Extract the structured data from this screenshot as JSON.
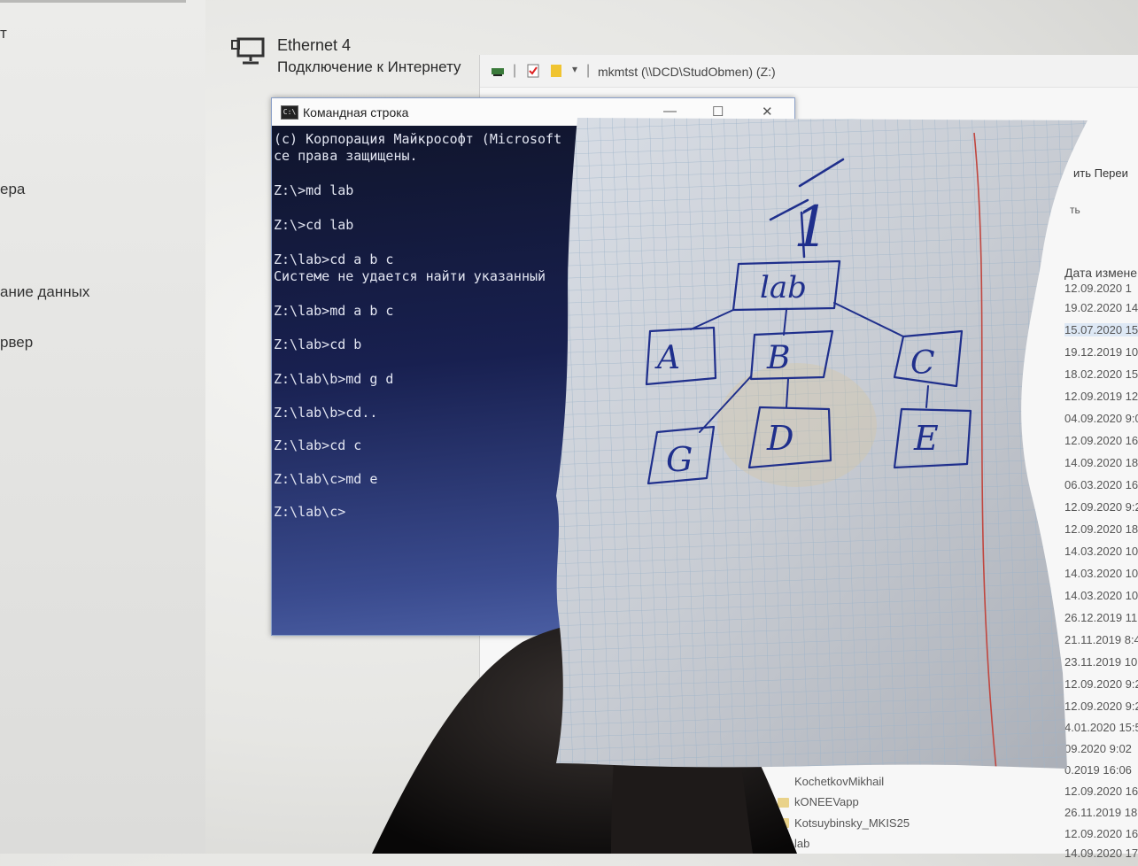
{
  "left_panel": {
    "items": [
      "т",
      "ера",
      "ание данных",
      "рвер"
    ]
  },
  "network": {
    "name": "Ethernet 4",
    "status": "Подключение к Интернету"
  },
  "explorer": {
    "title": "mkmtst (\\\\DCD\\StudObmen) (Z:)",
    "ribbon_label_1": "ить Переи",
    "ribbon_label_2": "ть",
    "date_header": "Дата измене",
    "dates": [
      "12.09.2020 1",
      "19.02.2020 14",
      "15.07.2020 15",
      "19.12.2019 10:",
      "18.02.2020 15:",
      "12.09.2019 12:",
      "04.09.2020 9:0",
      "12.09.2020 16:",
      "14.09.2020 18:0",
      "06.03.2020 16:0",
      "12.09.2020 9:22",
      "12.09.2020 18:1",
      "14.03.2020 10:0",
      "14.03.2020 10:0",
      "14.03.2020 10:0",
      "26.12.2019 11:00",
      "21.11.2019 8:46",
      "23.11.2019 10:50",
      "12.09.2020 9:21",
      "12.09.2020 9:20",
      "4.01.2020 15:57",
      "09.2020 9:02",
      "0.2019 16:06",
      "12.09.2020 16:32",
      "26.11.2019 18:43",
      "12.09.2020 16:42",
      "14.09.2020 17:59"
    ],
    "names": [
      "KochetkovMikhail",
      "kONEEVapp",
      "Kotsuybinsky_MKIS25",
      "lab"
    ]
  },
  "cmd": {
    "title": "Командная строка",
    "minimize": "—",
    "maximize": "☐",
    "close": "✕",
    "lines": [
      "(c) Корпорация Майкрософт (Microsoft",
      "се права защищены.",
      "",
      "Z:\\>md lab",
      "",
      "Z:\\>cd lab",
      "",
      "Z:\\lab>cd a b c",
      "Системе не удается найти указанный",
      "",
      "Z:\\lab>md a b c",
      "",
      "Z:\\lab>cd b",
      "",
      "Z:\\lab\\b>md g d",
      "",
      "Z:\\lab\\b>cd..",
      "",
      "Z:\\lab>cd c",
      "",
      "Z:\\lab\\c>md e",
      "",
      "Z:\\lab\\c>"
    ]
  },
  "sketch": {
    "root": "1",
    "folder": "lab",
    "children": [
      "A",
      "B",
      "C"
    ],
    "grandchildren": [
      "G",
      "D",
      "E"
    ],
    "ink_color": "#1f2f8c"
  }
}
